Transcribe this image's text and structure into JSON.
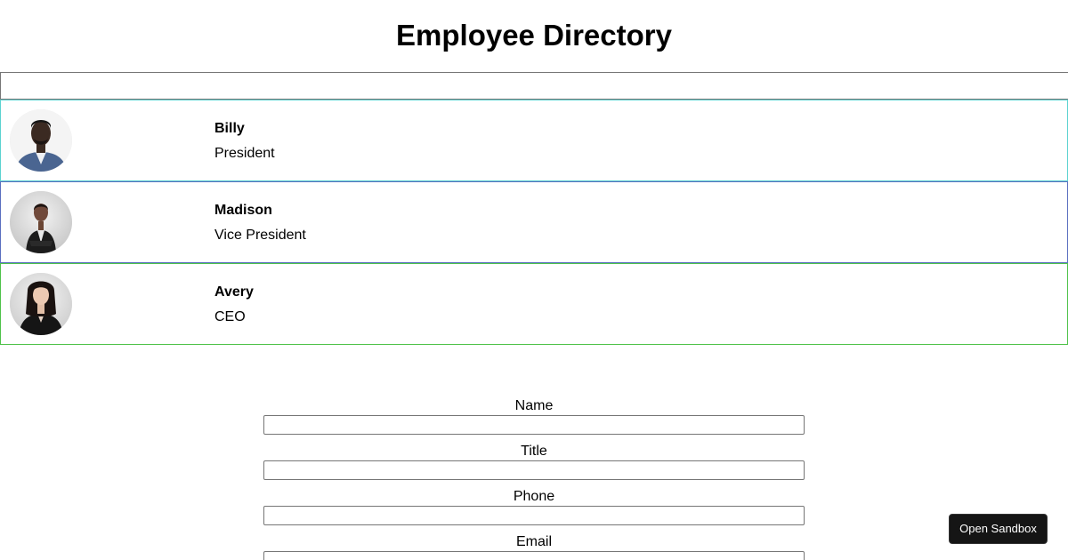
{
  "header": {
    "title": "Employee Directory"
  },
  "search": {
    "value": "",
    "placeholder": ""
  },
  "employees": [
    {
      "name": "Billy",
      "title": "President",
      "border_color": "#5bd2d0"
    },
    {
      "name": "Madison",
      "title": "Vice President",
      "border_color": "#5a6fc0"
    },
    {
      "name": "Avery",
      "title": "CEO",
      "border_color": "#4fc24a"
    }
  ],
  "form": {
    "fields": [
      {
        "label": "Name",
        "value": ""
      },
      {
        "label": "Title",
        "value": ""
      },
      {
        "label": "Phone",
        "value": ""
      },
      {
        "label": "Email",
        "value": ""
      }
    ]
  },
  "sandbox": {
    "label": "Open Sandbox"
  }
}
